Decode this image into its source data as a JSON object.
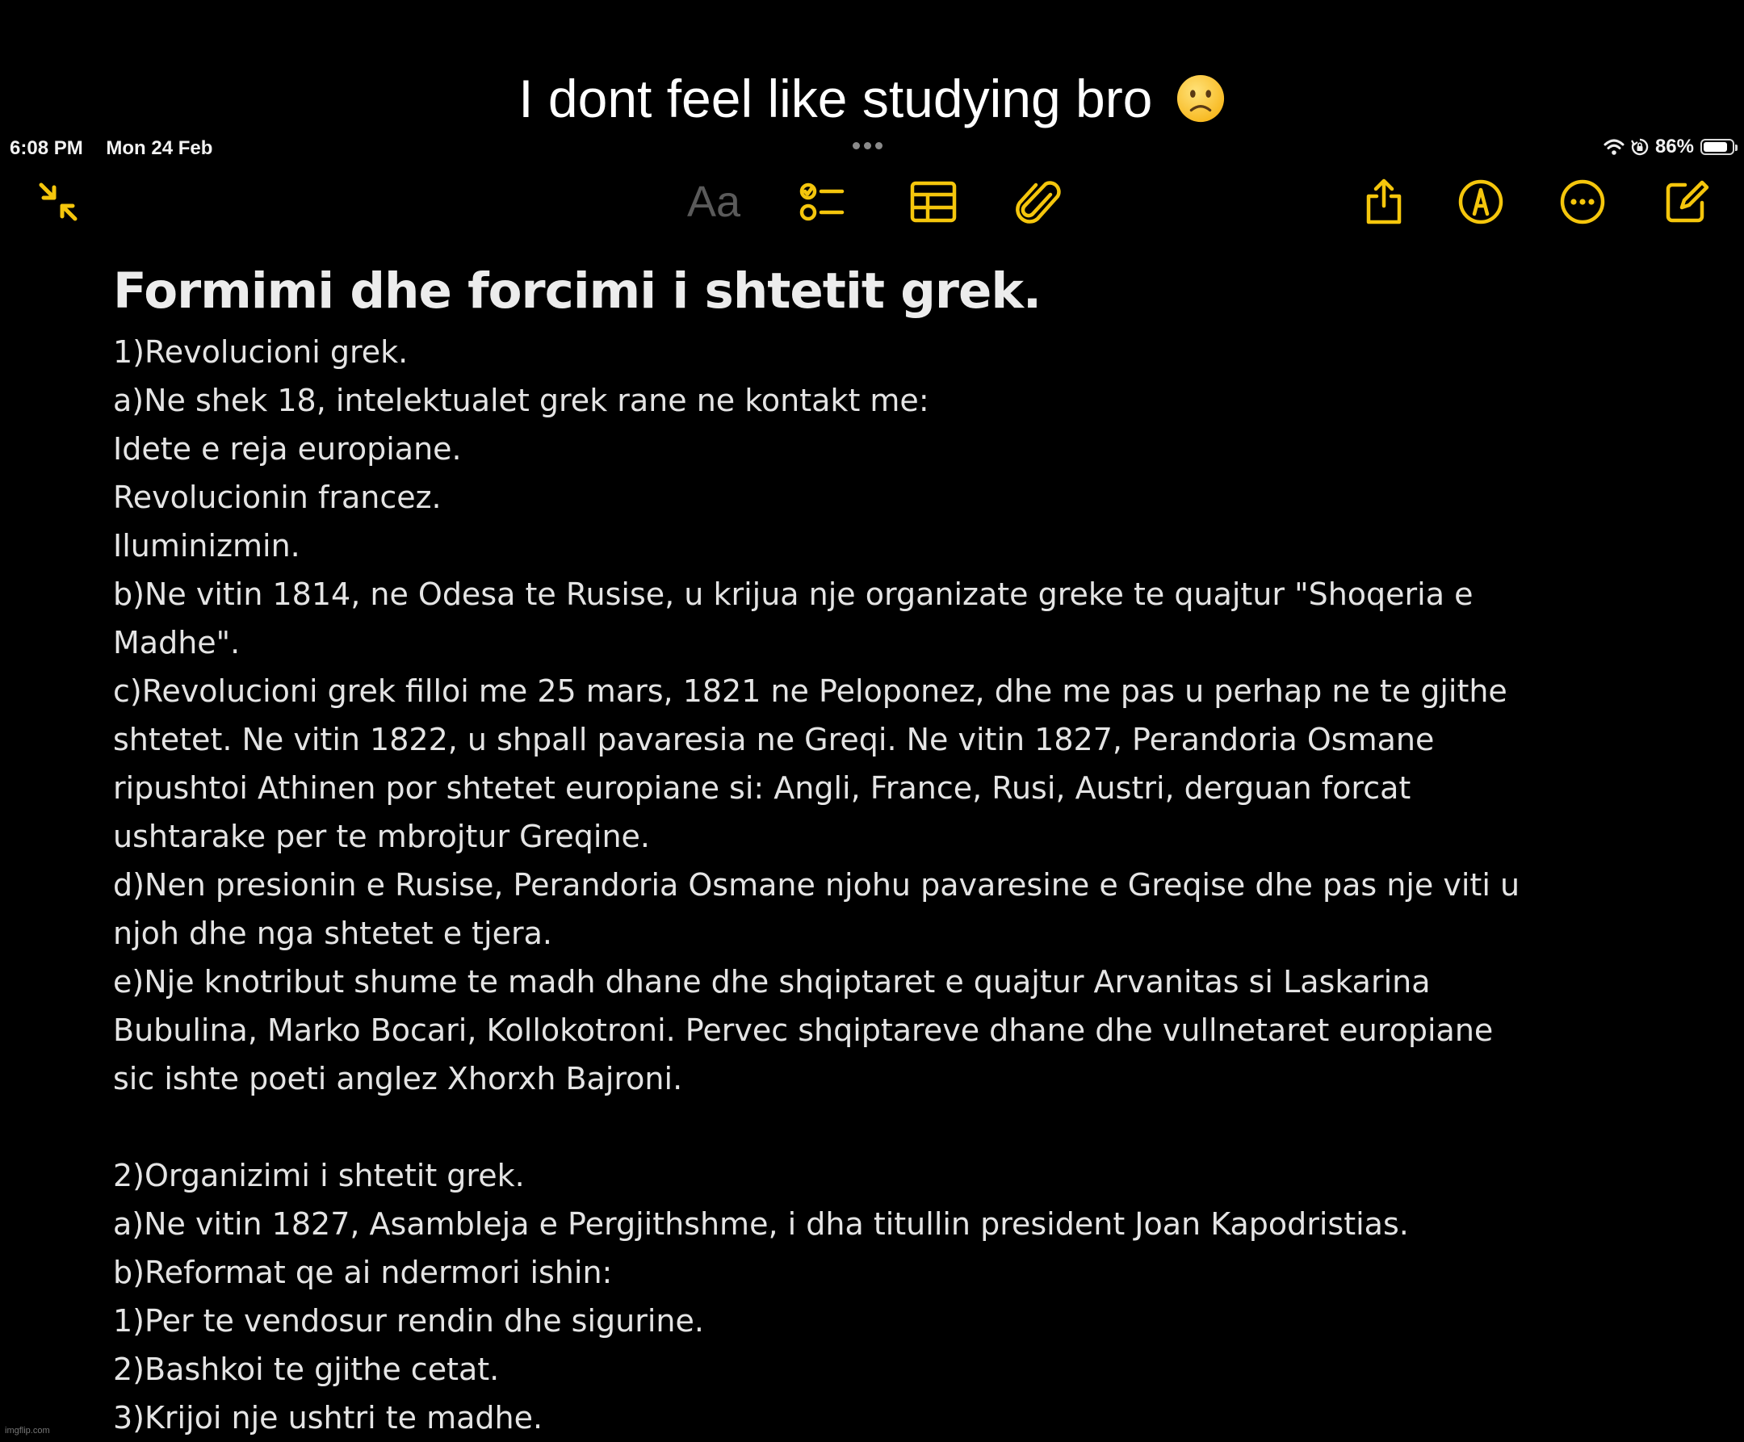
{
  "caption": {
    "text": "I dont feel like studying bro",
    "emoji": "slightly-frowning-face"
  },
  "status_bar": {
    "time": "6:08 PM",
    "date": "Mon 24 Feb",
    "battery_text": "86%",
    "battery_level": 0.86,
    "icons": [
      "wifi-icon",
      "orientation-lock-icon",
      "battery-icon"
    ]
  },
  "toolbar": {
    "format_label": "Aa",
    "icons": [
      "collapse-icon",
      "checklist-icon",
      "table-icon",
      "attachment-icon",
      "share-icon",
      "markup-icon",
      "more-icon",
      "compose-icon"
    ],
    "accent_color": "#F5C60C"
  },
  "note": {
    "title": "Formimi dhe forcimi i shtetit grek.",
    "lines": [
      "1)Revolucioni grek.",
      "a)Ne shek 18, intelektualet grek rane ne kontakt me:",
      "Idete e reja europiane.",
      "Revolucionin francez.",
      "Iluminizmin.",
      "b)Ne vitin 1814, ne Odesa te Rusise, u krijua nje organizate greke te quajtur \"Shoqeria e",
      "Madhe\".",
      "c)Revolucioni grek filloi me 25 mars, 1821 ne Peloponez, dhe me pas u perhap ne te gjithe",
      "shtetet. Ne vitin 1822, u shpall pavaresia ne Greqi. Ne vitin 1827, Perandoria Osmane",
      "ripushtoi Athinen por shtetet europiane si: Angli, France, Rusi, Austri, derguan forcat",
      "ushtarake per te mbrojtur Greqine.",
      "d)Nen presionin e Rusise, Perandoria Osmane njohu pavaresine e Greqise dhe pas nje viti u",
      "njoh dhe nga shtetet e tjera.",
      "e)Nje knotribut shume te madh dhane dhe shqiptaret e quajtur Arvanitas si Laskarina",
      "Bubulina, Marko Bocari, Kollokotroni. Pervec shqiptareve dhane dhe vullnetaret europiane",
      "sic ishte poeti anglez Xhorxh Bajroni.",
      "",
      "2)Organizimi i shtetit grek.",
      "a)Ne vitin 1827, Asambleja e Pergjithshme, i dha titullin president Joan Kapodristias.",
      "b)Reformat qe ai ndermori ishin:",
      "1)Per te vendosur rendin dhe sigurine.",
      "2)Bashkoi te gjithe cetat.",
      "3)Krijoi nje ushtri te madhe."
    ]
  },
  "watermark": "imgflip.com"
}
